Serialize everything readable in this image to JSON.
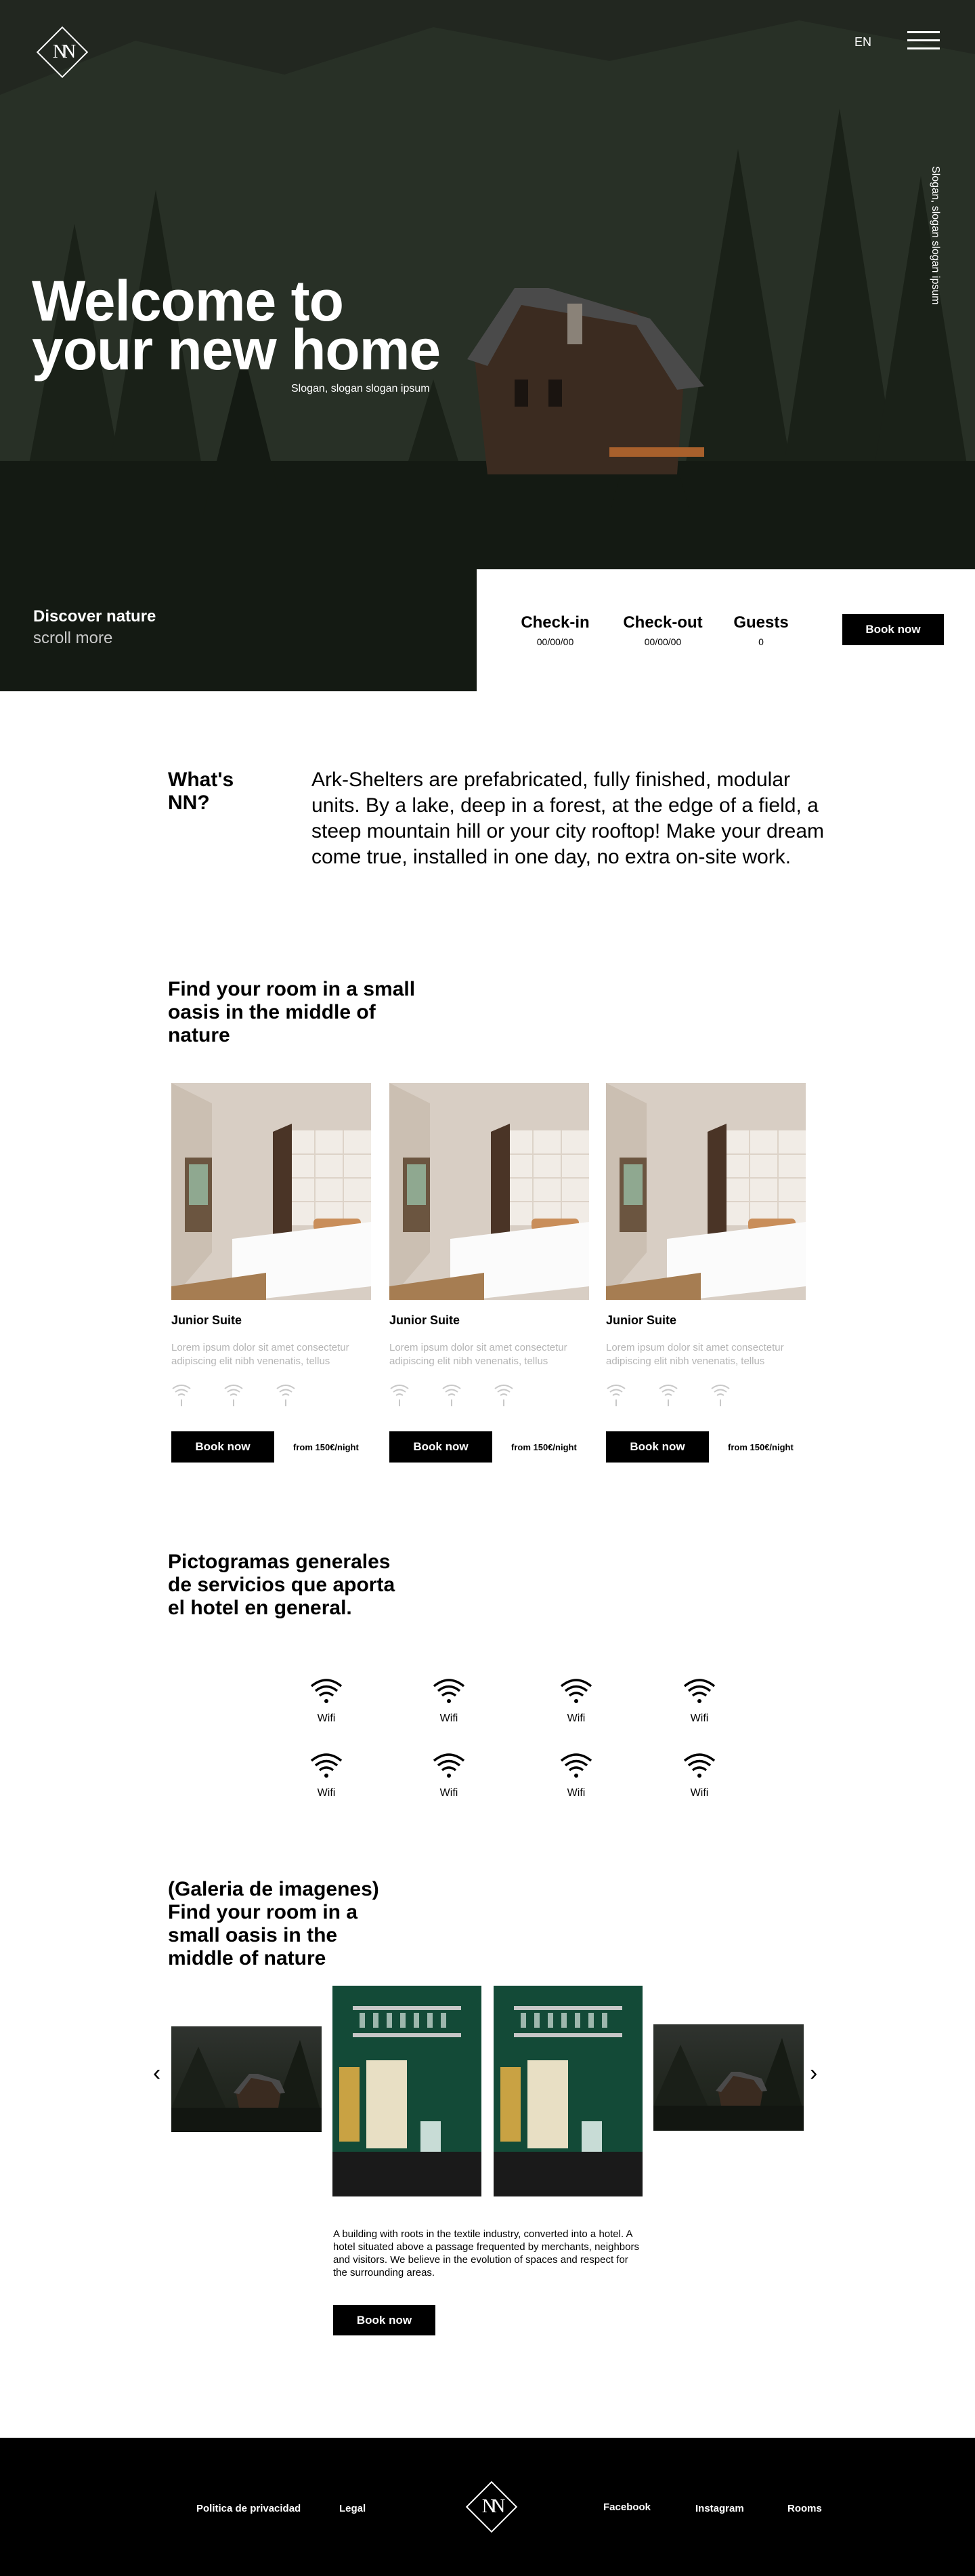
{
  "header": {
    "logo_text": "NN",
    "lang": "EN",
    "vertical_slogan": "Slogan, slogan slogan ipsum"
  },
  "hero": {
    "title_line1": "Welcome to",
    "title_line2": "your new home",
    "slogan": "Slogan, slogan slogan ipsum",
    "discover": "Discover nature",
    "scroll": "scroll more"
  },
  "booking": {
    "checkin_label": "Check-in",
    "checkin_value": "00/00/00",
    "checkout_label": "Check-out",
    "checkout_value": "00/00/00",
    "guests_label": "Guests",
    "guests_value": "0",
    "button": "Book now"
  },
  "about": {
    "heading_line1": "What's",
    "heading_line2": "NN?",
    "text": "Ark-Shelters are prefabricated, fully finished, modular units. By a lake, deep in a forest, at the edge of a field,  a steep mountain hill or your city rooftop! Make your dream come true, installed in one day, no extra on-site work."
  },
  "rooms": {
    "heading_line1": "Find your room in a small",
    "heading_line2": "oasis in the middle of",
    "heading_line3": "nature",
    "items": [
      {
        "title": "Junior Suite",
        "desc": "Lorem ipsum dolor sit amet consectetur adipiscing elit nibh venenatis, tellus",
        "button": "Book now",
        "price": "from 150€/night"
      },
      {
        "title": "Junior Suite",
        "desc": "Lorem ipsum dolor sit amet consectetur adipiscing elit nibh venenatis, tellus",
        "button": "Book now",
        "price": "from 150€/night"
      },
      {
        "title": "Junior Suite",
        "desc": "Lorem ipsum dolor sit amet consectetur adipiscing elit nibh venenatis, tellus",
        "button": "Book now",
        "price": "from 150€/night"
      }
    ]
  },
  "services": {
    "heading_line1": "Pictogramas generales",
    "heading_line2": "de servicios que aporta",
    "heading_line3": "el hotel en general.",
    "items": [
      "Wifi",
      "Wifi",
      "Wifi",
      "Wifi",
      "Wifi",
      "Wifi",
      "Wifi",
      "Wifi"
    ]
  },
  "gallery": {
    "heading_line1": "(Galeria de imagenes)",
    "heading_line2": "Find your room in a",
    "heading_line3": "small oasis in the",
    "heading_line4": "middle of nature",
    "prev": "‹",
    "next": "›",
    "text": "A building with roots in the textile industry, converted into a hotel. A hotel situated above a passage frequented by merchants, neighbors and visitors. We believe in the evolution of spaces and respect for the surrounding areas.",
    "button": "Book now"
  },
  "footer": {
    "privacy": "Politica de privacidad",
    "legal": "Legal",
    "logo_text": "NN",
    "facebook": "Facebook",
    "instagram": "Instagram",
    "rooms": "Rooms"
  },
  "colors": {
    "accent": "#000000",
    "muted_text": "#b5b5b5",
    "hero_dark": "#1f241d"
  }
}
